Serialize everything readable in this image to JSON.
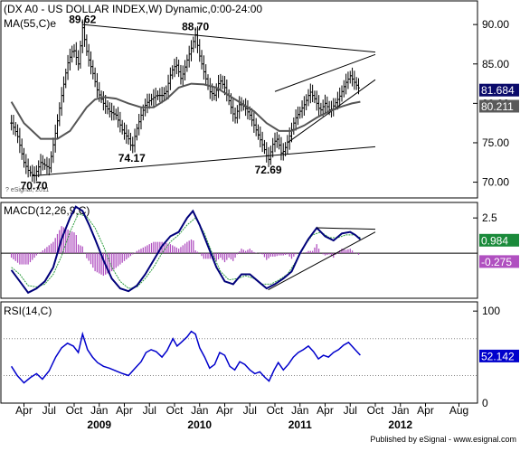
{
  "chart_data": [
    {
      "panel": "price",
      "type": "line",
      "title": "(DX A0 - US DOLLAR INDEX,W) Dynamic,0:00-24:00",
      "ma_label": "MA(55,C)e",
      "watermark": "? eSignal, 2011",
      "ylim": [
        68,
        93
      ],
      "yticks": [
        70,
        75,
        80,
        85,
        90
      ],
      "ytick_labels": [
        "70.00",
        "75.00",
        "80.00",
        "85.00",
        "90.00"
      ],
      "last_price_label": "81.684",
      "ma_value_label": "80.211",
      "annotations": [
        {
          "text": "89.62",
          "t": 2.0,
          "value": 89.62
        },
        {
          "text": "88.70",
          "t": 15.5,
          "value": 88.7
        },
        {
          "text": "74.17",
          "t": 7.9,
          "value": 74.17
        },
        {
          "text": "72.69",
          "t": 24.2,
          "value": 72.69
        },
        {
          "text": "70.70",
          "t": -3.8,
          "value": 70.7
        }
      ],
      "price_keypoints": [
        [
          -6.5,
          77.5
        ],
        [
          -5.8,
          76.0
        ],
        [
          -5.0,
          72.5
        ],
        [
          -4.5,
          71.5
        ],
        [
          -3.8,
          70.7
        ],
        [
          -3.0,
          72.5
        ],
        [
          -2.0,
          71.8
        ],
        [
          -1.2,
          76.5
        ],
        [
          -0.5,
          81.0
        ],
        [
          0.2,
          85.0
        ],
        [
          0.9,
          87.0
        ],
        [
          1.5,
          85.0
        ],
        [
          2.0,
          89.6
        ],
        [
          2.6,
          86.0
        ],
        [
          3.2,
          84.0
        ],
        [
          3.8,
          81.5
        ],
        [
          4.5,
          80.0
        ],
        [
          5.2,
          79.0
        ],
        [
          6.0,
          78.5
        ],
        [
          6.8,
          76.5
        ],
        [
          7.5,
          75.5
        ],
        [
          7.9,
          74.2
        ],
        [
          8.4,
          76.5
        ],
        [
          9.0,
          78.5
        ],
        [
          9.6,
          80.0
        ],
        [
          10.2,
          80.5
        ],
        [
          10.8,
          81.0
        ],
        [
          11.5,
          81.0
        ],
        [
          12.0,
          81.5
        ],
        [
          12.6,
          84.0
        ],
        [
          13.2,
          85.0
        ],
        [
          13.8,
          83.0
        ],
        [
          14.5,
          85.5
        ],
        [
          15.0,
          87.0
        ],
        [
          15.5,
          88.7
        ],
        [
          16.0,
          86.0
        ],
        [
          16.5,
          84.0
        ],
        [
          17.2,
          81.5
        ],
        [
          17.8,
          81.0
        ],
        [
          18.4,
          83.0
        ],
        [
          19.0,
          82.0
        ],
        [
          19.6,
          80.0
        ],
        [
          20.2,
          78.0
        ],
        [
          20.8,
          80.0
        ],
        [
          21.4,
          79.5
        ],
        [
          22.0,
          78.5
        ],
        [
          22.6,
          77.0
        ],
        [
          23.2,
          75.5
        ],
        [
          23.8,
          74.0
        ],
        [
          24.2,
          72.7
        ],
        [
          24.8,
          75.0
        ],
        [
          25.3,
          75.5
        ],
        [
          25.8,
          73.5
        ],
        [
          26.3,
          74.5
        ],
        [
          26.8,
          76.0
        ],
        [
          27.4,
          78.0
        ],
        [
          28.0,
          79.0
        ],
        [
          28.6,
          80.0
        ],
        [
          29.2,
          81.5
        ],
        [
          29.8,
          80.5
        ],
        [
          30.4,
          79.0
        ],
        [
          31.0,
          80.0
        ],
        [
          31.6,
          79.0
        ],
        [
          32.2,
          80.0
        ],
        [
          32.8,
          81.0
        ],
        [
          33.4,
          82.5
        ],
        [
          34.0,
          83.5
        ],
        [
          34.6,
          82.5
        ],
        [
          35.2,
          81.7
        ]
      ],
      "ma_keypoints": [
        [
          -6.5,
          80.2
        ],
        [
          -5.0,
          77.5
        ],
        [
          -3.0,
          75.5
        ],
        [
          -1.0,
          75.5
        ],
        [
          0.5,
          76.5
        ],
        [
          1.5,
          78.0
        ],
        [
          2.5,
          79.5
        ],
        [
          3.5,
          80.5
        ],
        [
          4.5,
          80.8
        ],
        [
          6.0,
          80.6
        ],
        [
          7.5,
          80.0
        ],
        [
          9.0,
          79.5
        ],
        [
          10.5,
          79.5
        ],
        [
          12.0,
          80.5
        ],
        [
          13.5,
          82.0
        ],
        [
          15.0,
          82.5
        ],
        [
          16.5,
          82.4
        ],
        [
          18.0,
          82.0
        ],
        [
          19.5,
          81.0
        ],
        [
          21.0,
          80.0
        ],
        [
          22.5,
          79.0
        ],
        [
          24.0,
          77.5
        ],
        [
          25.5,
          76.5
        ],
        [
          27.0,
          76.5
        ],
        [
          28.5,
          77.2
        ],
        [
          30.0,
          78.2
        ],
        [
          31.5,
          79.0
        ],
        [
          33.0,
          79.6
        ],
        [
          34.2,
          80.0
        ],
        [
          35.2,
          80.2
        ]
      ],
      "trendlines": [
        [
          [
            2.0,
            90.0
          ],
          [
            37.0,
            86.5
          ]
        ],
        [
          [
            -4.0,
            70.8
          ],
          [
            37.0,
            74.5
          ]
        ],
        [
          [
            25.0,
            81.5
          ],
          [
            37.0,
            86.2
          ]
        ],
        [
          [
            26.5,
            75.0
          ],
          [
            37.0,
            83.0
          ]
        ]
      ]
    },
    {
      "panel": "macd",
      "type": "line",
      "title": "MACD(12,26,9,C)",
      "ylim": [
        -3.2,
        3.6
      ],
      "ytick_value": 2.5,
      "ytick_label": "2.5",
      "zero_line": 0,
      "macd_label": "0.984",
      "signal_label": "-0.275",
      "macd_keypoints": [
        [
          -6.5,
          -1.2
        ],
        [
          -5.5,
          -2.0
        ],
        [
          -4.5,
          -2.8
        ],
        [
          -3.5,
          -2.5
        ],
        [
          -2.5,
          -2.0
        ],
        [
          -1.5,
          -1.0
        ],
        [
          -0.5,
          1.0
        ],
        [
          0.5,
          2.5
        ],
        [
          1.2,
          3.3
        ],
        [
          2.0,
          3.0
        ],
        [
          2.8,
          2.0
        ],
        [
          3.5,
          1.0
        ],
        [
          4.5,
          -0.5
        ],
        [
          5.5,
          -1.8
        ],
        [
          6.5,
          -2.5
        ],
        [
          7.5,
          -2.7
        ],
        [
          8.5,
          -2.3
        ],
        [
          9.5,
          -1.5
        ],
        [
          10.5,
          -0.5
        ],
        [
          11.5,
          0.5
        ],
        [
          12.5,
          1.2
        ],
        [
          13.5,
          1.5
        ],
        [
          14.5,
          2.5
        ],
        [
          15.2,
          3.0
        ],
        [
          16.0,
          2.0
        ],
        [
          17.0,
          0.5
        ],
        [
          18.0,
          -1.0
        ],
        [
          19.0,
          -2.0
        ],
        [
          20.0,
          -2.2
        ],
        [
          21.0,
          -1.5
        ],
        [
          22.0,
          -1.5
        ],
        [
          23.0,
          -2.0
        ],
        [
          24.0,
          -2.5
        ],
        [
          25.0,
          -2.2
        ],
        [
          26.0,
          -1.8
        ],
        [
          27.0,
          -1.3
        ],
        [
          28.0,
          0.0
        ],
        [
          29.0,
          1.0
        ],
        [
          30.0,
          1.8
        ],
        [
          31.0,
          1.2
        ],
        [
          32.0,
          0.9
        ],
        [
          33.0,
          1.4
        ],
        [
          34.0,
          1.5
        ],
        [
          34.6,
          1.3
        ],
        [
          35.2,
          0.98
        ]
      ],
      "signal_keypoints": [
        [
          -6.5,
          -1.0
        ],
        [
          -5.5,
          -1.5
        ],
        [
          -4.5,
          -2.3
        ],
        [
          -3.5,
          -2.4
        ],
        [
          -2.5,
          -2.2
        ],
        [
          -1.5,
          -1.5
        ],
        [
          -0.5,
          -0.2
        ],
        [
          0.5,
          1.5
        ],
        [
          1.5,
          2.8
        ],
        [
          2.5,
          2.6
        ],
        [
          3.5,
          1.8
        ],
        [
          4.5,
          0.5
        ],
        [
          5.5,
          -1.0
        ],
        [
          6.5,
          -2.0
        ],
        [
          7.5,
          -2.5
        ],
        [
          8.5,
          -2.4
        ],
        [
          9.5,
          -1.8
        ],
        [
          10.5,
          -1.0
        ],
        [
          11.5,
          0.0
        ],
        [
          12.5,
          0.8
        ],
        [
          13.5,
          1.3
        ],
        [
          14.5,
          2.0
        ],
        [
          15.5,
          2.5
        ],
        [
          16.5,
          1.5
        ],
        [
          17.5,
          0.0
        ],
        [
          18.5,
          -1.3
        ],
        [
          19.5,
          -1.9
        ],
        [
          20.5,
          -1.8
        ],
        [
          21.5,
          -1.6
        ],
        [
          22.5,
          -1.8
        ],
        [
          23.5,
          -2.2
        ],
        [
          24.5,
          -2.2
        ],
        [
          25.5,
          -1.9
        ],
        [
          26.5,
          -1.5
        ],
        [
          27.5,
          -0.6
        ],
        [
          28.5,
          0.5
        ],
        [
          29.5,
          1.3
        ],
        [
          30.5,
          1.5
        ],
        [
          31.5,
          1.1
        ],
        [
          32.5,
          1.1
        ],
        [
          33.5,
          1.3
        ],
        [
          34.5,
          1.3
        ],
        [
          35.2,
          1.1
        ]
      ],
      "trendlines": [
        [
          [
            24.2,
            -2.6
          ],
          [
            37.0,
            1.5
          ]
        ],
        [
          [
            30.0,
            1.8
          ],
          [
            37.0,
            1.7
          ]
        ]
      ]
    },
    {
      "panel": "rsi",
      "type": "line",
      "title": "RSI(14,C)",
      "ylim": [
        0,
        110
      ],
      "yticks": [
        100,
        0
      ],
      "ytick_labels": [
        "100",
        "0"
      ],
      "reference_levels": [
        70,
        30
      ],
      "last_label": "52.142",
      "rsi_keypoints": [
        [
          -6.5,
          40
        ],
        [
          -5.8,
          30
        ],
        [
          -5.0,
          22
        ],
        [
          -4.2,
          28
        ],
        [
          -3.5,
          32
        ],
        [
          -2.8,
          26
        ],
        [
          -2.0,
          35
        ],
        [
          -1.2,
          50
        ],
        [
          -0.5,
          60
        ],
        [
          0.2,
          65
        ],
        [
          0.9,
          62
        ],
        [
          1.5,
          55
        ],
        [
          2.0,
          75
        ],
        [
          2.6,
          58
        ],
        [
          3.2,
          50
        ],
        [
          3.8,
          44
        ],
        [
          4.5,
          40
        ],
        [
          5.2,
          38
        ],
        [
          6.0,
          35
        ],
        [
          6.8,
          32
        ],
        [
          7.5,
          30
        ],
        [
          8.3,
          38
        ],
        [
          9.0,
          45
        ],
        [
          9.6,
          55
        ],
        [
          10.2,
          58
        ],
        [
          10.8,
          56
        ],
        [
          11.5,
          50
        ],
        [
          12.1,
          57
        ],
        [
          12.8,
          70
        ],
        [
          13.3,
          62
        ],
        [
          13.8,
          66
        ],
        [
          14.5,
          72
        ],
        [
          15.0,
          78
        ],
        [
          15.5,
          75
        ],
        [
          16.0,
          60
        ],
        [
          16.6,
          50
        ],
        [
          17.2,
          38
        ],
        [
          17.8,
          42
        ],
        [
          18.4,
          55
        ],
        [
          19.0,
          52
        ],
        [
          19.6,
          40
        ],
        [
          20.2,
          36
        ],
        [
          20.8,
          45
        ],
        [
          21.4,
          42
        ],
        [
          22.0,
          36
        ],
        [
          22.6,
          32
        ],
        [
          23.2,
          34
        ],
        [
          23.8,
          28
        ],
        [
          24.3,
          24
        ],
        [
          24.9,
          36
        ],
        [
          25.4,
          44
        ],
        [
          26.0,
          36
        ],
        [
          26.6,
          42
        ],
        [
          27.2,
          50
        ],
        [
          27.8,
          55
        ],
        [
          28.4,
          58
        ],
        [
          29.0,
          62
        ],
        [
          29.6,
          56
        ],
        [
          30.2,
          48
        ],
        [
          30.8,
          52
        ],
        [
          31.4,
          50
        ],
        [
          32.0,
          55
        ],
        [
          32.6,
          58
        ],
        [
          33.2,
          63
        ],
        [
          33.8,
          66
        ],
        [
          34.4,
          60
        ],
        [
          34.9,
          55
        ],
        [
          35.2,
          52.1
        ]
      ]
    }
  ],
  "x_axis": {
    "month_labels": [
      "Apr",
      "Jul",
      "Oct",
      "Jan",
      "Apr",
      "Jul",
      "Oct",
      "Jan",
      "Apr",
      "Jul",
      "Oct",
      "Jan",
      "Apr",
      "Jul",
      "Oct",
      "Jan",
      "Apr",
      "Aug"
    ],
    "month_positions": [
      -5,
      -2,
      1,
      4,
      7,
      10,
      13,
      16,
      19,
      22,
      25,
      28,
      31,
      34,
      37,
      40,
      43,
      47
    ],
    "year_labels": [
      "2009",
      "2010",
      "2011",
      "2012"
    ],
    "year_positions": [
      4,
      16,
      28,
      40
    ]
  },
  "footer": "Published by eSignal - www.esignal.com",
  "colors": {
    "price_bars": "#000000",
    "ma_line": "#555555",
    "trendline": "#000000",
    "macd_line": "#00007a",
    "signal_line": "#2e9e3e",
    "histogram": "#b050c0",
    "rsi_line": "#0000cc",
    "last_price_box": "#0a0a6a",
    "ma_box": "#5a5a5a",
    "macd_box": "#1a8a3a",
    "signal_box": "#b050c0",
    "rsi_box": "#0000cc",
    "panel_bg": "#ffffff",
    "grid": "#888888"
  }
}
